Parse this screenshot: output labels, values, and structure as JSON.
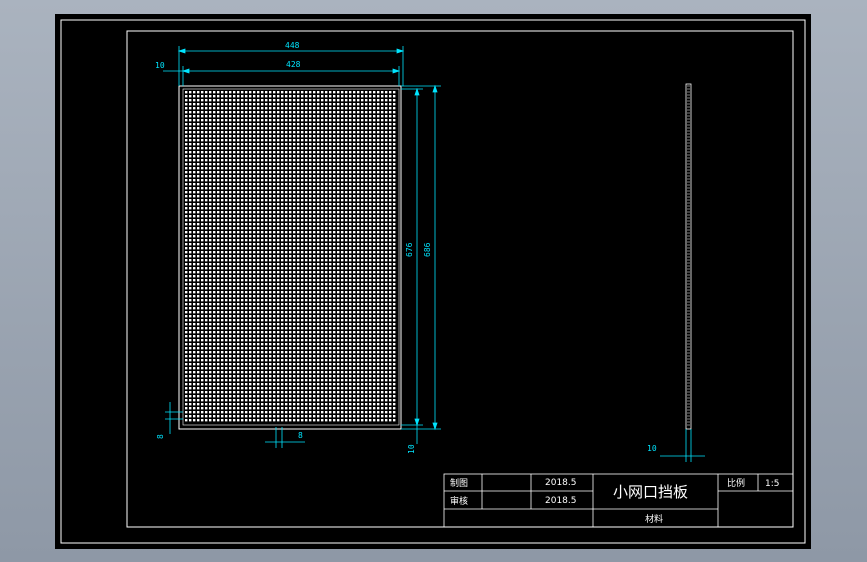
{
  "drawing": {
    "title": "小网口挡板",
    "scale_label": "比例",
    "scale_value": "1:5",
    "material_label": "材料",
    "rows": [
      {
        "label": "制图",
        "date": "2018.5"
      },
      {
        "label": "审核",
        "date": "2018.5"
      }
    ]
  },
  "dimensions": {
    "overall_width": "448",
    "inner_width": "428",
    "top_margin": "10",
    "overall_height": "686",
    "inner_height": "676",
    "bottom_margin": "10",
    "hole_spacing": "8",
    "hole_size": "8",
    "side_thickness": "10"
  },
  "colors": {
    "background": "#000000",
    "line": "#ffffff",
    "dimension": "#00e5ff"
  }
}
